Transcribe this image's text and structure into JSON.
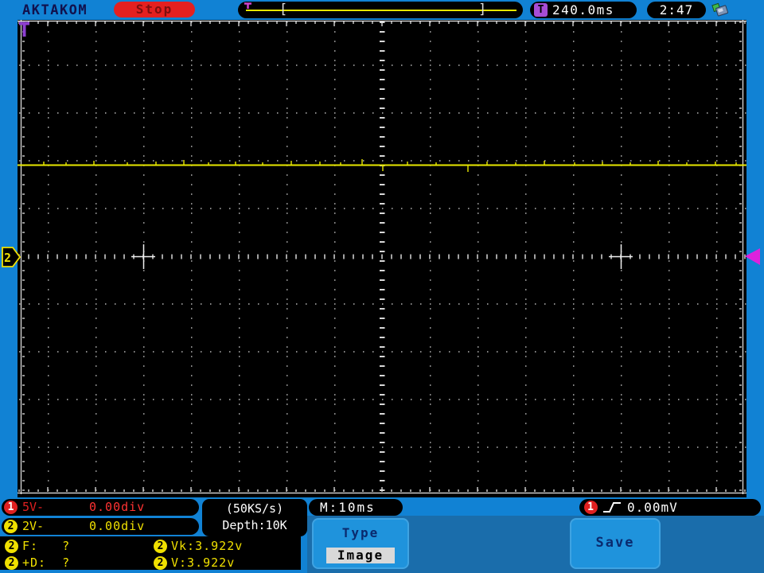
{
  "app": {
    "brand": "AKTAKOM",
    "status": "Stop",
    "clock": "2:47"
  },
  "trigger_bar": {
    "icon_letter": "T",
    "window_left_bracket": "[",
    "window_right_bracket": "]",
    "position_time": "240.0ms"
  },
  "channels": {
    "ch1": {
      "number": "1",
      "scale": "5V-",
      "position": "0.00div"
    },
    "ch2": {
      "number": "2",
      "scale": "2V-",
      "position": "0.00div"
    }
  },
  "acquisition": {
    "sample_rate": "(50KS/s)",
    "memory_depth": "Depth:10K"
  },
  "timebase": {
    "main": "M:10ms"
  },
  "trigger": {
    "source": "1",
    "level": "0.00mV"
  },
  "measurements": {
    "rows": [
      {
        "badge": "2",
        "text": "F:   ?"
      },
      {
        "badge": "2",
        "text": "Vk:3.922v"
      },
      {
        "badge": "2",
        "text": "+D:  ?"
      },
      {
        "badge": "2",
        "text": "V:3.922v"
      }
    ]
  },
  "menu": {
    "type_label": "Type",
    "type_value": "Image",
    "save_label": "Save"
  },
  "screen": {
    "ch2_marker_label": "2"
  },
  "colors": {
    "frame_blue": "#1182d4",
    "menu_band_blue": "#1a6dab",
    "button_blue": "#1f93dc",
    "button_border_blue": "#3fa3e2",
    "navy_text": "#0a2a6e",
    "brand_navy": "#11114d",
    "stop_red_bg": "#e42020",
    "stop_red_text": "#7d0f0f",
    "ch1_red": "#e02020",
    "ch1_red_bright": "#ff3232",
    "ch2_yellow": "#f0e000",
    "trace_yellow": "#e8e800",
    "highlight_bg": "#d9d9d9",
    "purple": "#8d3fd0",
    "magenta": "#dd22dd",
    "icon_purple_bg": "#a64dd6",
    "grid_dot": "#b8b8b8",
    "usb_green": "#3fba4a",
    "usb_gray": "#7b93b5"
  }
}
